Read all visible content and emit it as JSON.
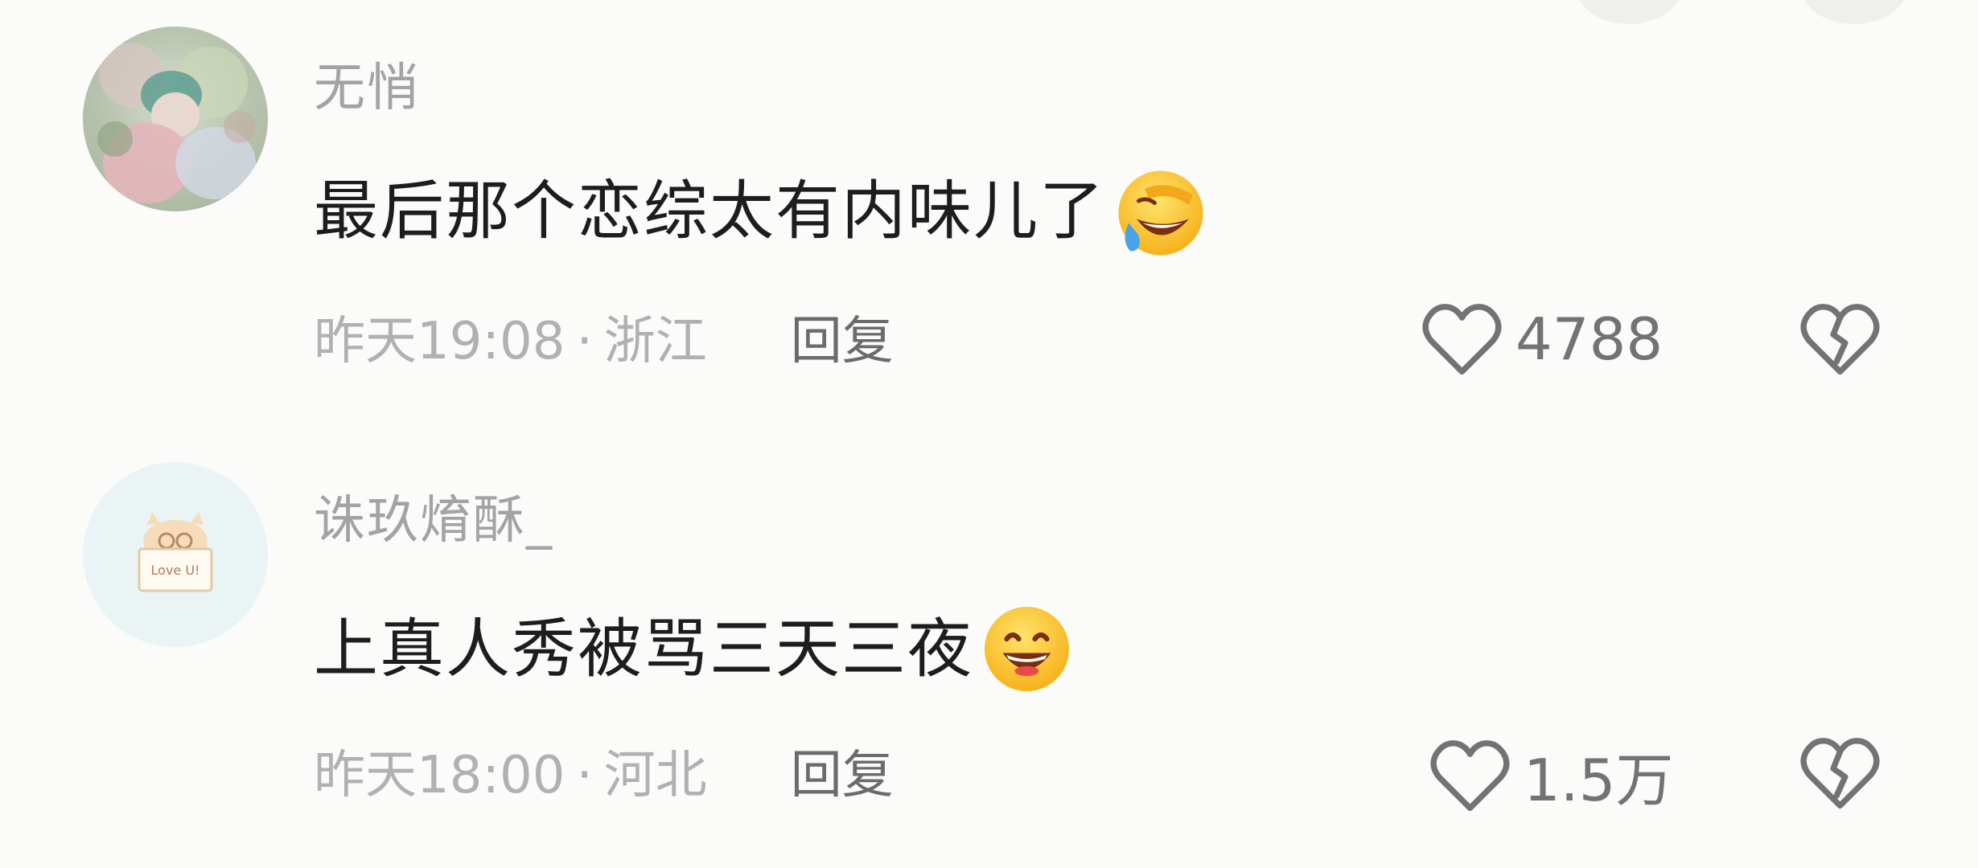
{
  "comments": [
    {
      "username": "无悄",
      "text": "最后那个恋综太有内味儿了",
      "emoji": "laughing-crying-face-icon",
      "time": "昨天19:08",
      "separator": "·",
      "location": "浙江",
      "reply_label": "回复",
      "likes": "4788"
    },
    {
      "username": "诛玖焴酥_",
      "text": "上真人秀被骂三天三夜",
      "emoji": "grinning-face-icon",
      "time": "昨天18:00",
      "separator": "·",
      "location": "河北",
      "reply_label": "回复",
      "likes": "1.5万"
    }
  ],
  "colors": {
    "background": "#fbfbf9",
    "username": "#a3a3a3",
    "text": "#1d1d1d",
    "meta": "#b1b1b1",
    "reply": "#6b6b6b",
    "icon": "#737373"
  }
}
